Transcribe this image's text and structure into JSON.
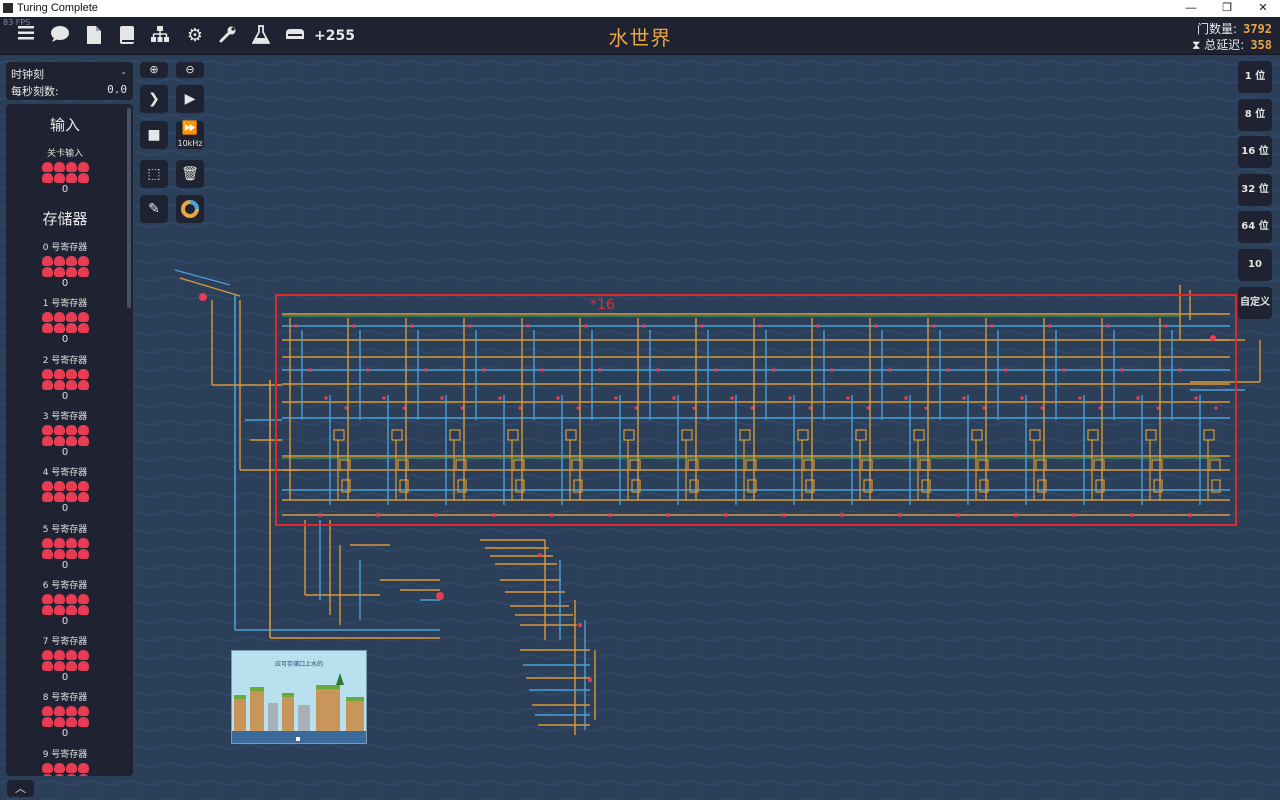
{
  "window": {
    "title": "Turing Complete",
    "fps": "83 FPS",
    "minimize": "—",
    "maximize": "❐",
    "close": "✕"
  },
  "topbar": {
    "icons": [
      "menu-icon",
      "chat-icon",
      "document-icon",
      "book-icon",
      "hierarchy-icon",
      "gear-icon",
      "wrench-icon",
      "flask-icon",
      "component-icon"
    ],
    "component_count": "+255",
    "world_title": "水世界",
    "gate_count_label": "门数量:",
    "gate_count_value": "3792",
    "delay_label": "⧗ 总延迟:",
    "delay_value": "358"
  },
  "clock": {
    "tick_label": "时钟刻",
    "tick_value": "-",
    "tps_label": "每秒刻数:",
    "tps_value": "0.0"
  },
  "sidebar": {
    "inputs_heading": "输入",
    "level_input_label": "关卡输入",
    "level_input_value": "0",
    "storage_heading": "存储器",
    "registers": [
      {
        "label": "0 号寄存器",
        "value": "0"
      },
      {
        "label": "1 号寄存器",
        "value": "0"
      },
      {
        "label": "2 号寄存器",
        "value": "0"
      },
      {
        "label": "3 号寄存器",
        "value": "0"
      },
      {
        "label": "4 号寄存器",
        "value": "0"
      },
      {
        "label": "5 号寄存器",
        "value": "0"
      },
      {
        "label": "6 号寄存器",
        "value": "0"
      },
      {
        "label": "7 号寄存器",
        "value": "0"
      },
      {
        "label": "8 号寄存器",
        "value": "0"
      },
      {
        "label": "9 号寄存器",
        "value": ""
      }
    ]
  },
  "tools": {
    "fast_label": "10kHz"
  },
  "bit_widths": [
    "1 位",
    "8 位",
    "16 位",
    "32 位",
    "64 位",
    "10",
    "自定义"
  ],
  "canvas": {
    "annotation": "*16",
    "preview_caption": "应可存储口上水的"
  },
  "colors": {
    "wire_orange": "#d99a3a",
    "wire_blue": "#4aa0d8",
    "bit_red": "#e83c55",
    "selection": "#e02828"
  }
}
